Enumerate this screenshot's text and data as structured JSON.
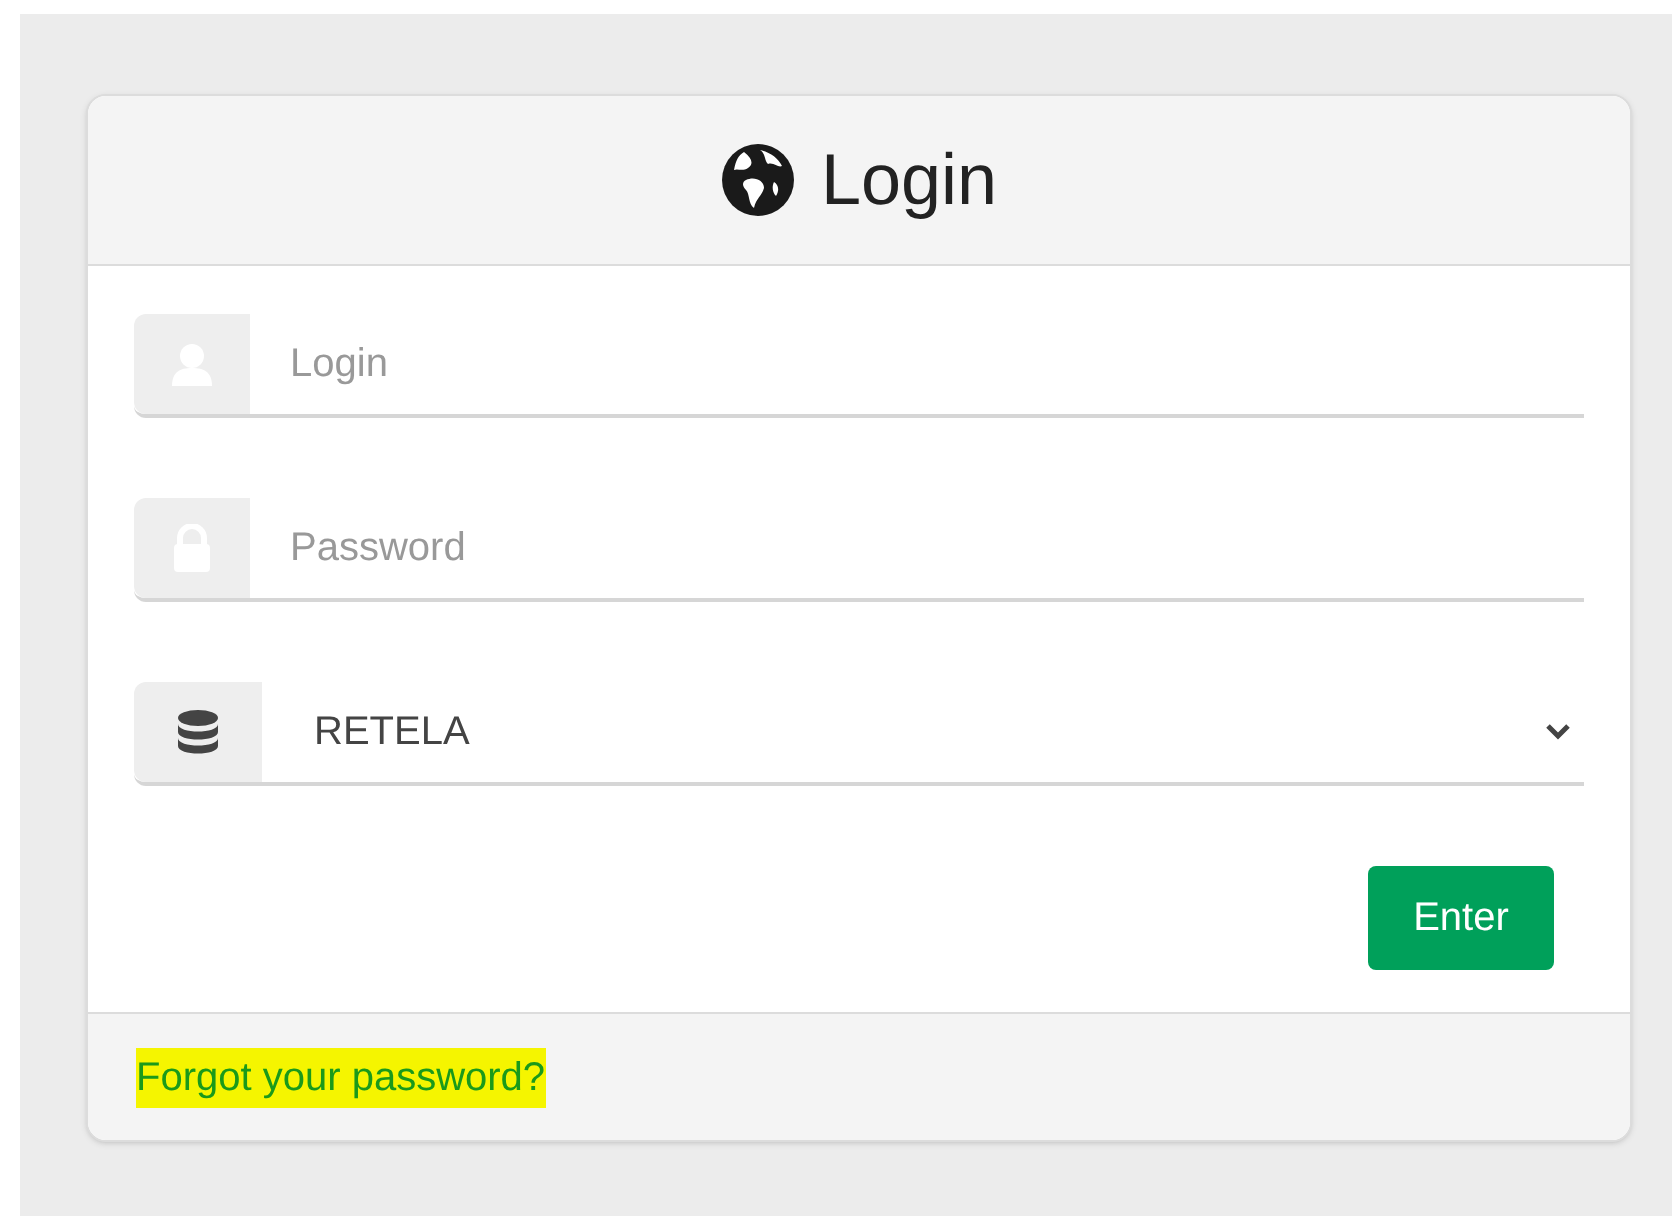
{
  "title": "Login",
  "fields": [
    {
      "kind": "text",
      "placeholder": "Login"
    },
    {
      "kind": "password",
      "placeholder": "Password"
    },
    {
      "kind": "select",
      "value": "RETELA"
    }
  ],
  "submit_button": "Enter",
  "footer_link": {
    "label": "Forgot your password?",
    "highlighted": true
  }
}
